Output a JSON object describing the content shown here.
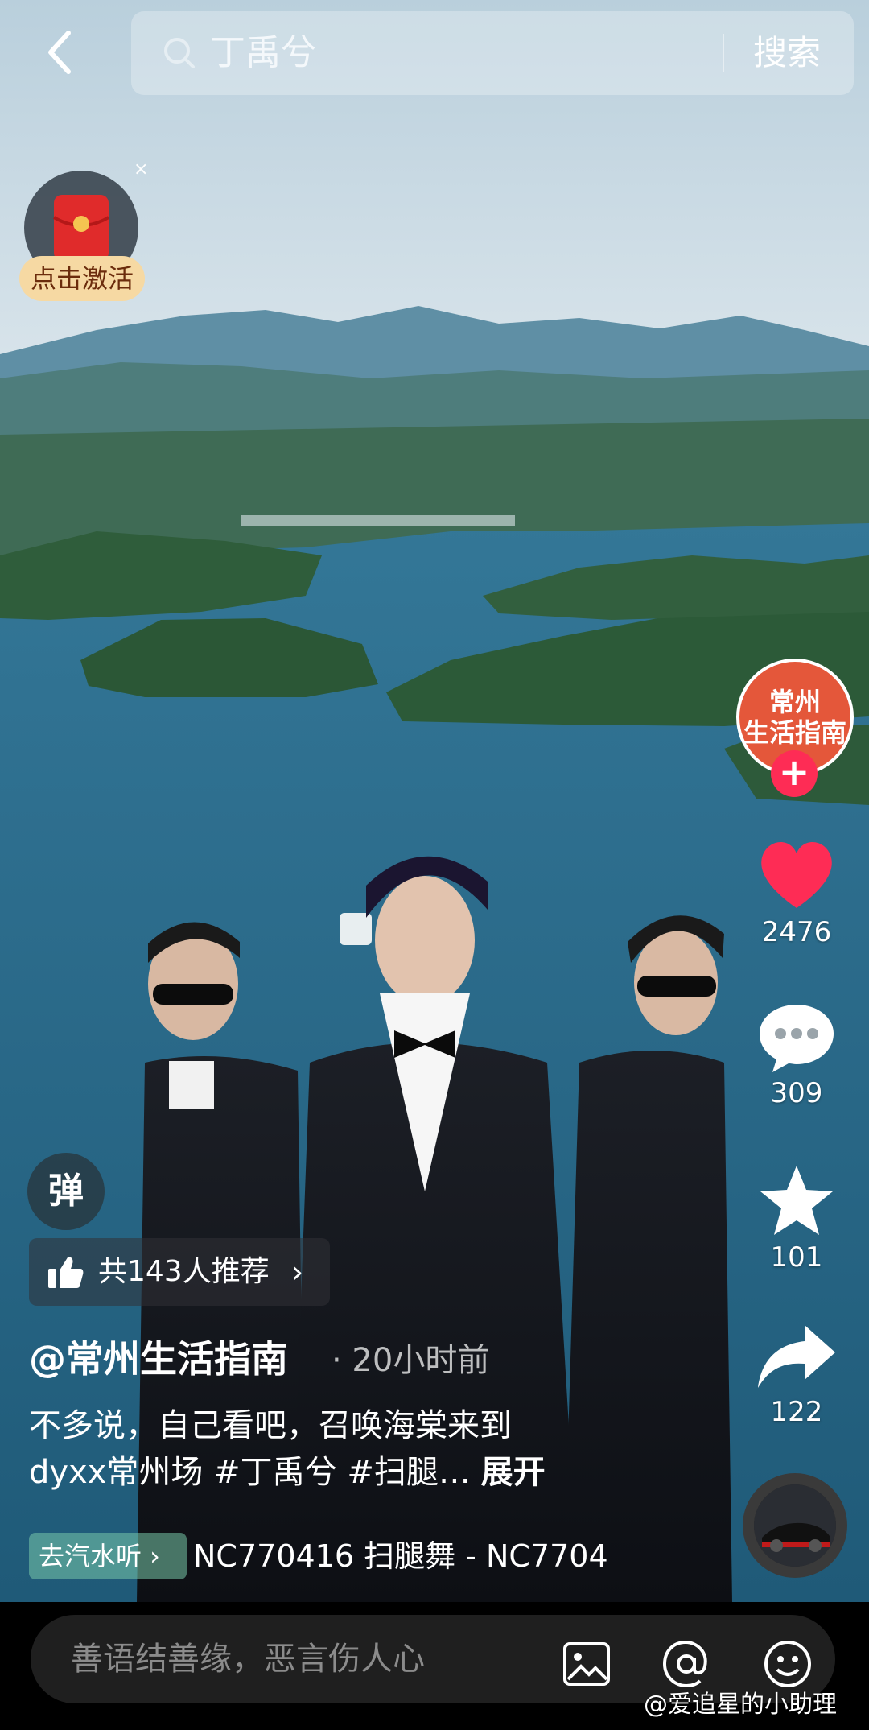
{
  "search": {
    "query": "丁禹兮",
    "submit_label": "搜索"
  },
  "redpacket": {
    "label": "点击激活",
    "close": "×"
  },
  "author": {
    "avatar_text_line1": "常州",
    "avatar_text_line2": "生活指南",
    "follow_symbol": "+",
    "handle": "@常州生活指南",
    "post_time": "· 20小时前"
  },
  "actions": {
    "likes": "2476",
    "comments": "309",
    "favorites": "101",
    "shares": "122"
  },
  "danmu": {
    "label": "弹"
  },
  "recommend": {
    "label": "共143人推荐",
    "chevron": "›"
  },
  "caption": {
    "line1": "不多说，自己看吧，召唤海棠来到",
    "line2": "dyxx常州场 #丁禹兮 #扫腿… ",
    "expand": "展开"
  },
  "music": {
    "chip_label": "去汽水听 ›",
    "track": "NC770416     扫腿舞 - NC7704"
  },
  "comment_bar": {
    "placeholder": "善语结善缘，恶言伤人心"
  },
  "watermark": "@爱追星的小助理",
  "colors": {
    "like_red": "#fe2c55",
    "follow_red": "#fe2c55",
    "lake": "#2c6f8e",
    "sky": "#c8dbe6"
  }
}
